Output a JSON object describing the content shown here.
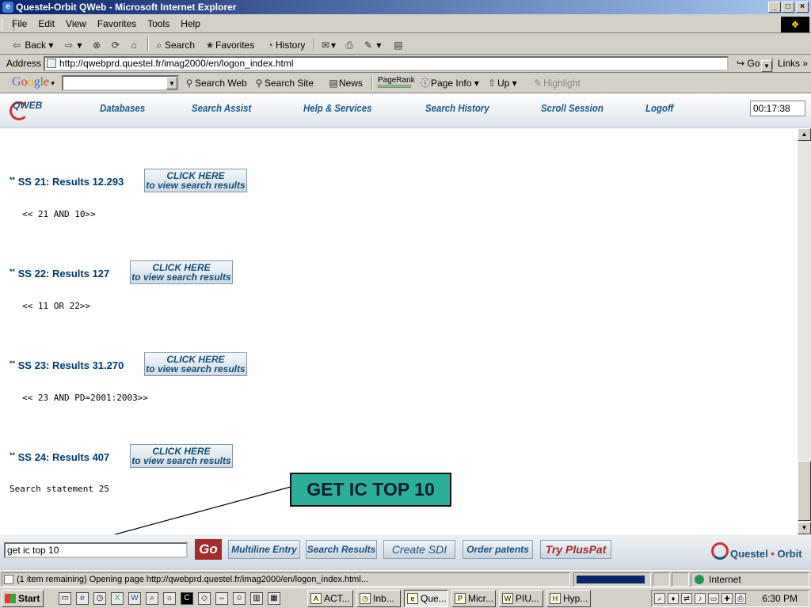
{
  "window": {
    "title": "Questel-Orbit QWeb - Microsoft Internet Explorer"
  },
  "menu": [
    "File",
    "Edit",
    "View",
    "Favorites",
    "Tools",
    "Help"
  ],
  "toolbar": {
    "back": "Back",
    "search": "Search",
    "favorites": "Favorites",
    "history": "History"
  },
  "address": {
    "label": "Address",
    "url": "http://qwebprd.questel.fr/imag2000/en/logon_index.html",
    "go": "Go",
    "links": "Links"
  },
  "google": {
    "logo": "Google",
    "search_web": "Search Web",
    "search_site": "Search Site",
    "news": "News",
    "pagerank": "PageRank",
    "page_info": "Page Info",
    "up": "Up",
    "highlight": "Highlight"
  },
  "qweb": {
    "logo": "QWEB",
    "nav": [
      "Databases",
      "Search Assist",
      "Help & Services",
      "Search History",
      "Scroll Session",
      "Logoff"
    ],
    "timer": "00:17:38"
  },
  "results": [
    {
      "label": "SS 21: Results 12.293",
      "button": [
        "CLICK HERE",
        "to view search results"
      ],
      "query": "<< 21 AND  10>>"
    },
    {
      "label": "SS 22: Results 127",
      "button": [
        "CLICK HERE",
        "to view search results"
      ],
      "query": "<< 11 OR  22>>"
    },
    {
      "label": "SS 23: Results 31.270",
      "button": [
        "CLICK HERE",
        "to view search results"
      ],
      "query": "<< 23 AND PD=2001:2003>>"
    },
    {
      "label": "SS 24: Results 407",
      "button": [
        "CLICK HERE",
        "to view search results"
      ],
      "query": ""
    }
  ],
  "statement": "Search statement  25",
  "callout": "GET IC TOP 10",
  "command": {
    "input_value": "get ic top 10",
    "go": "Go",
    "buttons": [
      "Multiline Entry",
      "Search Results",
      "Create SDI",
      "Order patents"
    ],
    "try_pluspat": "Try PlusPat",
    "brand": "Questel",
    "brand2": "Orbit"
  },
  "status": {
    "text": "(1 item remaining) Opening page http://qwebprd.questel.fr/imag2000/en/logon_index.html...",
    "zone": "Internet",
    "progress": 0.95
  },
  "taskbar": {
    "start": "Start",
    "tasks": [
      "ACT...",
      "Inb...",
      "Que...",
      "Micr...",
      "PIU...",
      "Hyp..."
    ],
    "clock": "6:30 PM"
  },
  "colors": {
    "accent": "#0a246a",
    "callout": "#2ab09a",
    "nav_text": "#1a5a8a",
    "go_button": "#a52a2a"
  }
}
